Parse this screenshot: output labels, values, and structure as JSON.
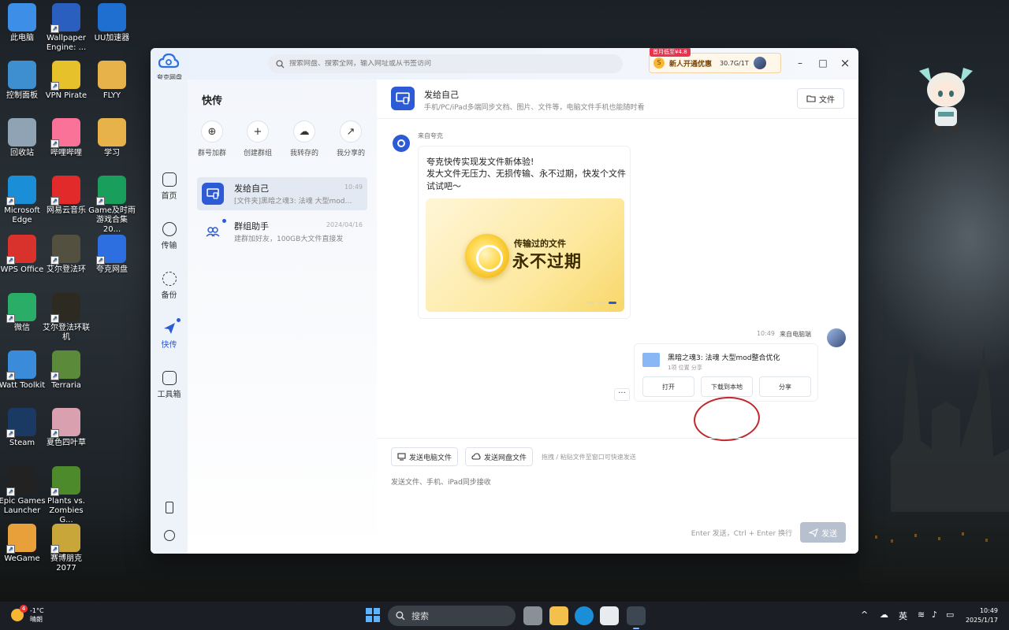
{
  "desktop": {
    "icons": [
      {
        "label": "此电脑",
        "color": "#3d8ee6"
      },
      {
        "label": "Wallpaper Engine: ...",
        "color": "#2a5fbf"
      },
      {
        "label": "UU加速器",
        "color": "#1f6fd1"
      },
      {
        "label": "控制面板",
        "color": "#3e8fcf"
      },
      {
        "label": "VPN Pirate",
        "color": "#e6c12c"
      },
      {
        "label": "FLYY",
        "color": "#e8b24a"
      },
      {
        "label": "回收站",
        "color": "#8fa3b5"
      },
      {
        "label": "哔哩哔哩",
        "color": "#fb7299"
      },
      {
        "label": "学习",
        "color": "#e8b24a"
      },
      {
        "label": "Microsoft Edge",
        "color": "#1a8fd8"
      },
      {
        "label": "网易云音乐",
        "color": "#e22a2a"
      },
      {
        "label": "Game及时雨 游戏合集20...",
        "color": "#1a9e5c"
      },
      {
        "label": "WPS Office",
        "color": "#d9312b"
      },
      {
        "label": "艾尔登法环",
        "color": "#54503f"
      },
      {
        "label": "夸克网盘",
        "color": "#2d6fe0"
      },
      {
        "label": "微信",
        "color": "#2aae67"
      },
      {
        "label": "艾尔登法环联机",
        "color": "#2d2a22"
      },
      {
        "label": "Watt Toolkit",
        "color": "#3a8bd9"
      },
      {
        "label": "Terraria",
        "color": "#5a8a3a"
      },
      {
        "label": "Steam",
        "color": "#1b3a63"
      },
      {
        "label": "夏色四叶草",
        "color": "#d9a0b0"
      },
      {
        "label": "Epic Games Launcher",
        "color": "#222222"
      },
      {
        "label": "Plants vs. Zombies G...",
        "color": "#4c8a2c"
      },
      {
        "label": "WeGame",
        "color": "#e8a03a"
      },
      {
        "label": "赛博朋克 2077",
        "color": "#c9a63a"
      }
    ]
  },
  "app": {
    "logo_label": "夸克网盘",
    "search": {
      "placeholder": "搜索网盘、搜索全网，输入网址或从书签访问"
    },
    "promo": {
      "badge": "首月低至¥4.8",
      "text": "新人开通优惠",
      "quota": "30.7G/1T"
    },
    "window_controls": {
      "minimize": "–",
      "maximize": "□",
      "close": "×"
    },
    "nav": [
      {
        "label": "首页"
      },
      {
        "label": "传输"
      },
      {
        "label": "备份"
      },
      {
        "label": "快传"
      },
      {
        "label": "工具箱"
      }
    ],
    "list": {
      "title": "快传",
      "quick_actions": [
        {
          "label": "群号加群",
          "icon": "person-add-icon",
          "glyph": "⊕"
        },
        {
          "label": "创建群组",
          "icon": "create-group-icon",
          "glyph": "+"
        },
        {
          "label": "我转存的",
          "icon": "cloud-save-icon",
          "glyph": "☁"
        },
        {
          "label": "我分享的",
          "icon": "share-out-icon",
          "glyph": "↗"
        }
      ],
      "conversations": [
        {
          "title": "发给自己",
          "preview": "[文件夹]黑暗之魂3: 法魂 大型mod整...",
          "time": "10:49"
        },
        {
          "title": "群组助手",
          "preview": "建群加好友，100GB大文件直接发",
          "time": "2024/04/16"
        }
      ]
    },
    "chat": {
      "title": "发给自己",
      "subtitle": "手机/PC/iPad多端同步文档、图片、文件等，电脑文件手机也能随时看",
      "file_button": "文件",
      "incoming": {
        "from": "来自夸克",
        "line1": "夸克快传实现发文件新体验!",
        "line2": "发大文件无压力、无损传输、永不过期，快发个文件试试吧～",
        "banner_line1": "传输过的文件",
        "banner_line2": "永不过期"
      },
      "outgoing": {
        "time": "10:49",
        "from": "来自电脑端",
        "file_name": "黑暗之魂3: 法魂 大型mod整合优化",
        "file_meta": "1项  位置  分享",
        "btn_open": "打开",
        "btn_download": "下载到本地",
        "btn_share": "分享",
        "more": "···"
      },
      "composer": {
        "send_pc": "发送电脑文件",
        "send_cloud": "发送网盘文件",
        "drag_hint": "拖拽 / 粘贴文件至窗口可快速发送",
        "placeholder": "发送文件、手机、iPad同步接收",
        "send_hint": "Enter 发送，Ctrl + Enter 换行",
        "send": "发送"
      }
    }
  },
  "taskbar": {
    "weather_temp": "-1°C",
    "weather_desc": "晴朗",
    "weather_badge": "4",
    "search": "搜索",
    "ime": "英",
    "time": "10:49",
    "date": "2025/1/17"
  }
}
